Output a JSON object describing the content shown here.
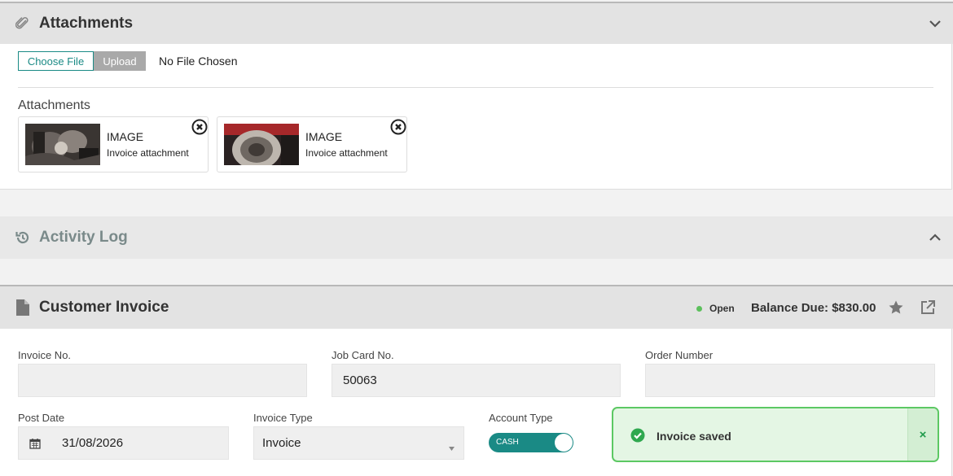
{
  "attachments": {
    "title": "Attachments",
    "choose_label": "Choose File",
    "upload_label": "Upload",
    "no_file_text": "No File Chosen",
    "list_heading": "Attachments",
    "items": [
      {
        "type": "IMAGE",
        "description": "Invoice attachment"
      },
      {
        "type": "IMAGE",
        "description": "Invoice attachment"
      }
    ]
  },
  "activity_log": {
    "title": "Activity Log"
  },
  "invoice": {
    "title": "Customer Invoice",
    "status": "Open",
    "status_color": "#5cc05c",
    "balance": "Balance Due: $830.00",
    "fields": {
      "invoice_no": {
        "label": "Invoice No.",
        "value": ""
      },
      "job_card_no": {
        "label": "Job Card No.",
        "value": "50063"
      },
      "order_number": {
        "label": "Order Number",
        "value": ""
      },
      "post_date": {
        "label": "Post Date",
        "value": "31/08/2026"
      },
      "invoice_type": {
        "label": "Invoice Type",
        "value": "Invoice"
      },
      "account_type": {
        "label": "Account Type",
        "value": "CASH"
      }
    }
  },
  "toast": {
    "message": "Invoice saved",
    "close": "×"
  },
  "colors": {
    "accent": "#1a8a85",
    "success": "#5cc863"
  }
}
